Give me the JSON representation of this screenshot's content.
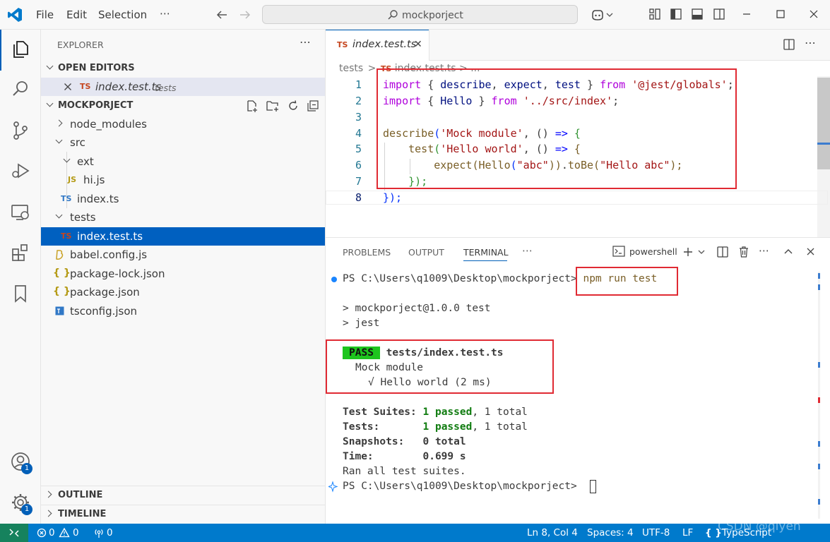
{
  "titlebar": {
    "menu": [
      "File",
      "Edit",
      "Selection",
      "⋯"
    ],
    "search_text": "mockporject"
  },
  "activity": {
    "account_badge": "1",
    "manage_badge": "1"
  },
  "sidebar": {
    "title": "EXPLORER",
    "more": "⋯",
    "open_editors": {
      "title": "OPEN EDITORS",
      "item": {
        "icon": "TS",
        "name": "index.test.ts",
        "folder": "tests"
      }
    },
    "project": {
      "title": "MOCKPORJECT",
      "items": [
        {
          "label": "node_modules"
        },
        {
          "label": "src"
        },
        {
          "label": "ext"
        },
        {
          "icon": "JS",
          "label": "hi.js"
        },
        {
          "icon": "TS",
          "label": "index.ts"
        },
        {
          "label": "tests"
        },
        {
          "icon": "TS",
          "label": "index.test.ts"
        },
        {
          "label": "babel.config.js"
        },
        {
          "icon": "{ }",
          "label": "package-lock.json"
        },
        {
          "icon": "{ }",
          "label": "package.json"
        },
        {
          "label": "tsconfig.json"
        }
      ]
    },
    "outline": "OUTLINE",
    "timeline": "TIMELINE"
  },
  "editor": {
    "tab": {
      "icon": "TS",
      "label": "index.test.ts",
      "close": "✕"
    },
    "breadcrumb": {
      "folder": "tests",
      "sep": ">",
      "icon": "TS",
      "file": "index.test.ts",
      "more": "> ..."
    },
    "line_numbers": [
      "1",
      "2",
      "3",
      "4",
      "5",
      "6",
      "7",
      "8"
    ]
  },
  "code": {
    "l1": [
      "import",
      " { ",
      "describe",
      ", ",
      "expect",
      ", ",
      "test",
      " } ",
      "from",
      " ",
      "'@jest/globals'",
      ";"
    ],
    "l2": [
      "import",
      " { ",
      "Hello",
      " } ",
      "from",
      " ",
      "'../src/index'",
      ";"
    ],
    "l4": [
      "describe",
      "(",
      "'Mock module'",
      ", () ",
      "=>",
      " {"
    ],
    "l5": [
      "    ",
      "test",
      "(",
      "'Hello world'",
      ", () ",
      "=>",
      " {"
    ],
    "l6": [
      "        ",
      "expect",
      "(",
      "Hello",
      "(",
      "\"abc\"",
      "))",
      ".",
      "toBe",
      "(",
      "\"Hello abc\"",
      ");"
    ],
    "l7": [
      "    ",
      "}",
      ");"
    ],
    "l8": [
      "}",
      ");"
    ]
  },
  "panel": {
    "tabs": [
      "PROBLEMS",
      "OUTPUT",
      "TERMINAL",
      "⋯"
    ],
    "shell": "powershell",
    "prompt": "PS C:\\Users\\q1009\\Desktop\\mockporject>",
    "command": "npm run test",
    "lines": {
      "script1": "> mockporject@1.0.0 test",
      "script2": "> jest",
      "pass_badge": "PASS",
      "pass_file": "tests/index.test.ts",
      "suite": "Mock module",
      "test_result": "√ Hello world (2 ms)",
      "suites_label": "Test Suites: ",
      "suites_passed": "1 passed",
      "suites_total": ", 1 total",
      "tests_label": "Tests:       ",
      "tests_passed": "1 passed",
      "tests_total": ", 1 total",
      "snapshots": "Snapshots:   0 total",
      "time": "Time:        0.699 s",
      "ran": "Ran all test suites."
    }
  },
  "statusbar": {
    "remote": "><",
    "errors": "0",
    "warnings": "0",
    "ports": "0",
    "position": "Ln 8, Col 4",
    "spaces": "Spaces: 4",
    "encoding": "UTF-8",
    "eol": "LF",
    "language": "TypeScript",
    "watermark": "CSDN @qiyen"
  }
}
